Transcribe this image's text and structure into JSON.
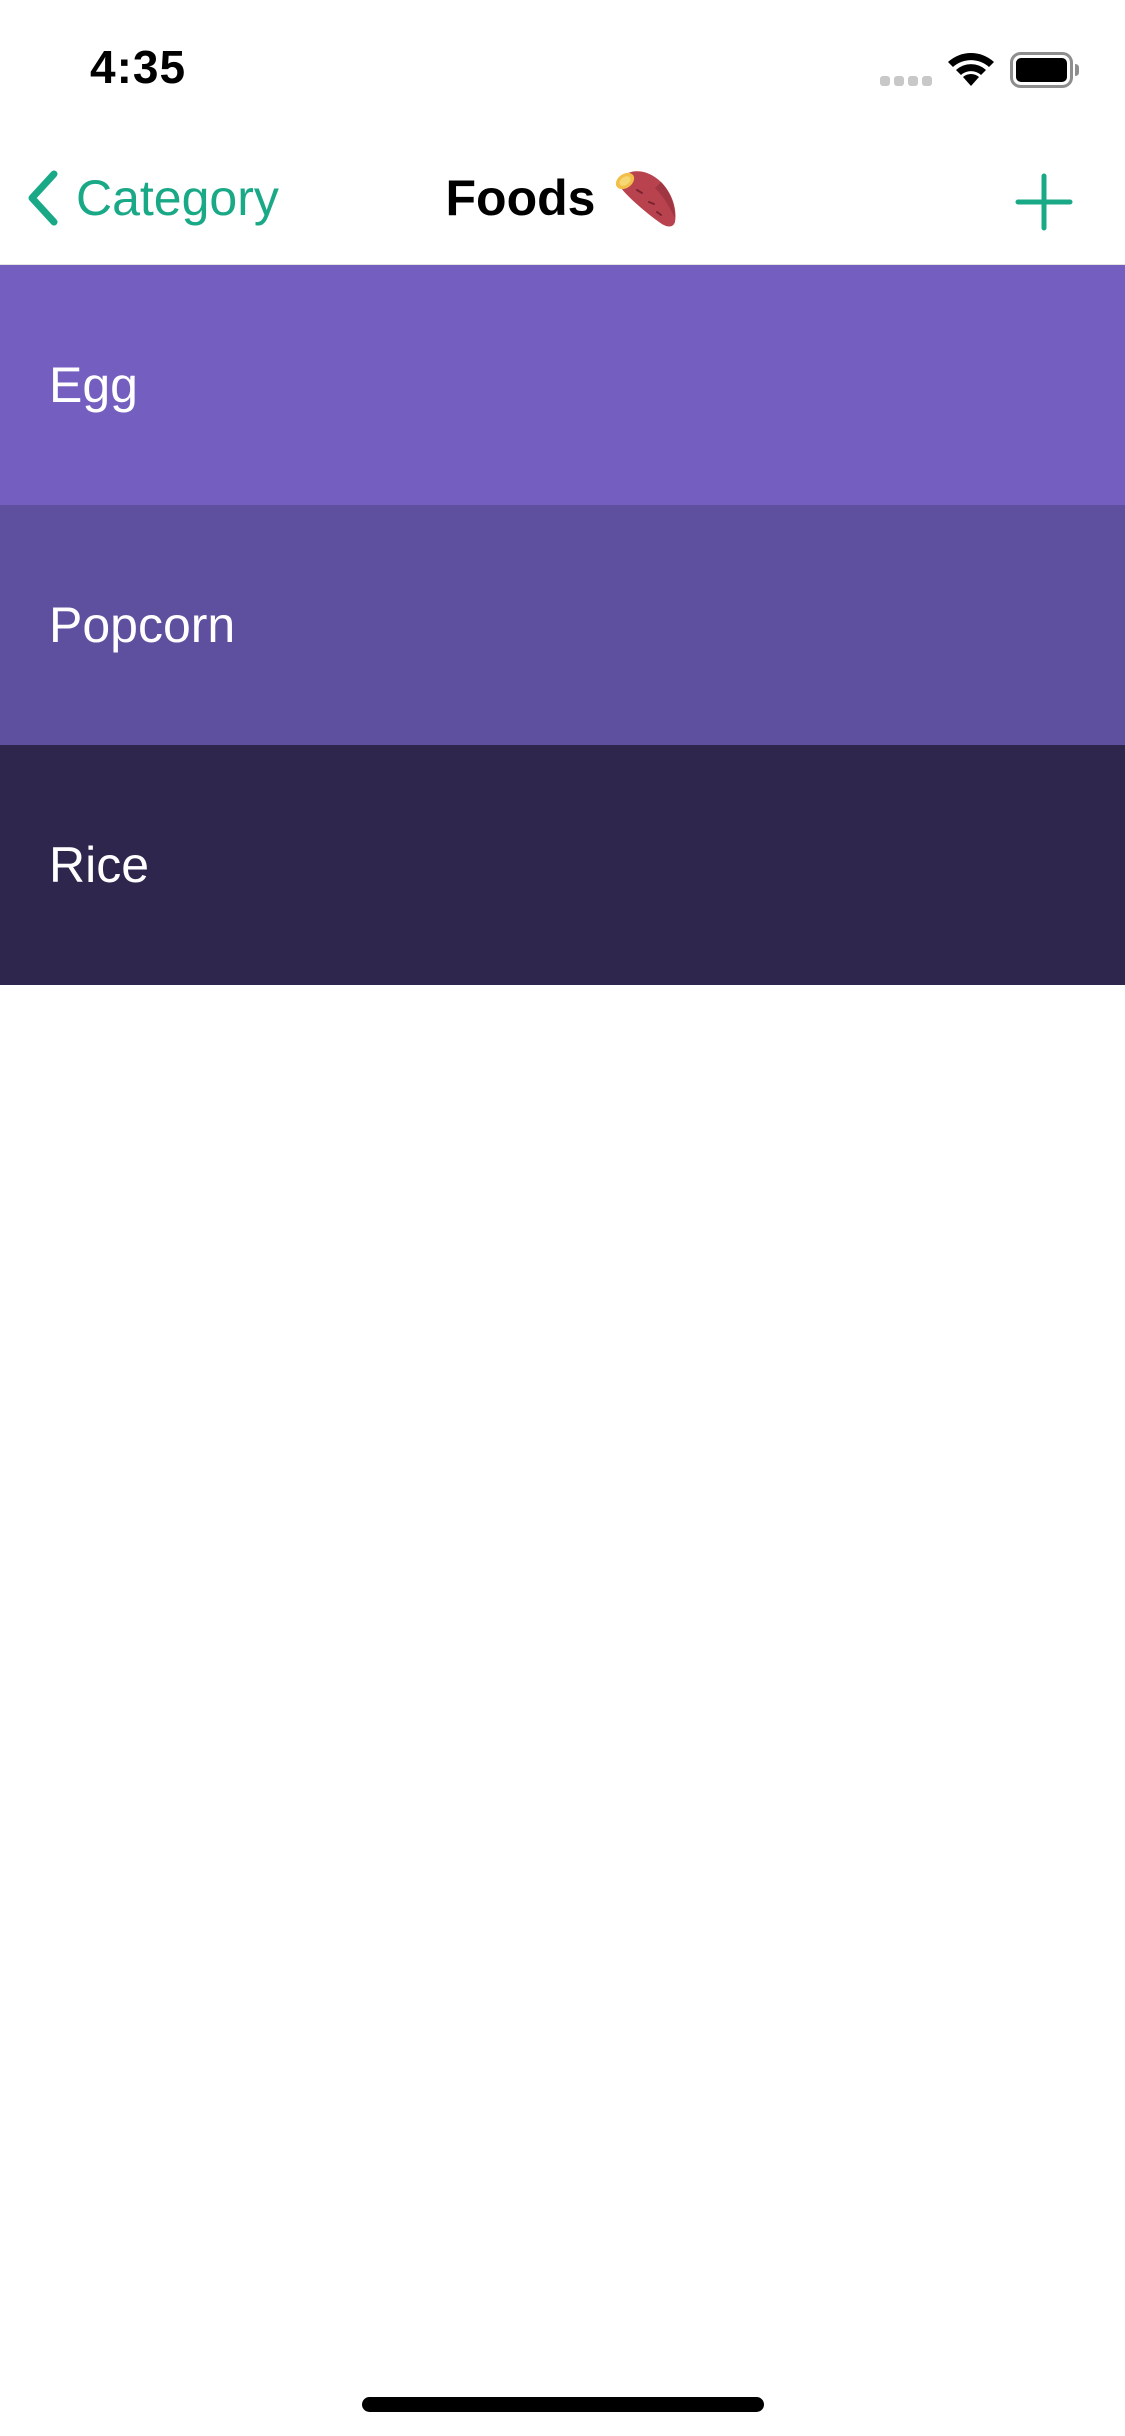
{
  "status_bar": {
    "time": "4:35",
    "icons": [
      "cellular-signal-icon",
      "wifi-icon",
      "battery-icon"
    ]
  },
  "nav": {
    "back_label": "Category",
    "title": "Foods",
    "title_icon": "sweet-potato-icon",
    "add_icon": "plus-icon",
    "accent_color": "#1aa987"
  },
  "items": [
    {
      "label": "Egg",
      "color": "#745fc0"
    },
    {
      "label": "Popcorn",
      "color": "#5f4f9f"
    },
    {
      "label": "Rice",
      "color": "#2f264d"
    }
  ]
}
